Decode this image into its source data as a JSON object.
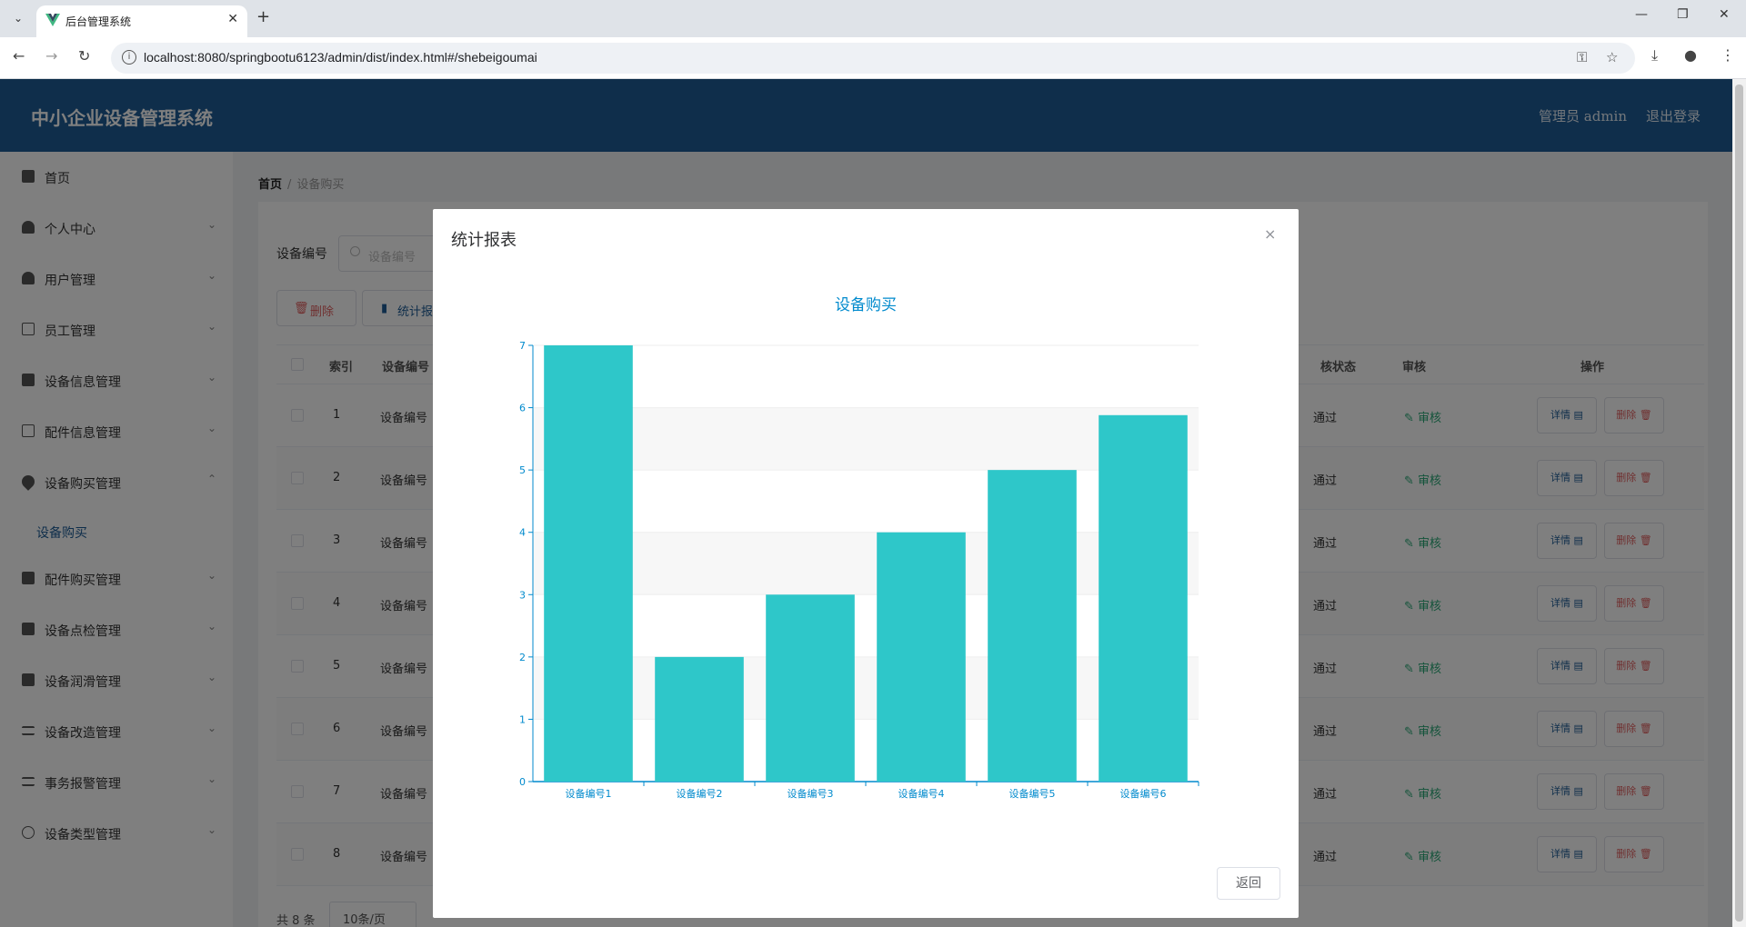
{
  "browser": {
    "tab_title": "后台管理系统",
    "url": "localhost:8080/springbootu6123/admin/dist/index.html#/shebeigoumai"
  },
  "header": {
    "brand": "中小企业设备管理系统",
    "user": "管理员 admin",
    "logout": "退出登录"
  },
  "sidebar": {
    "items": [
      {
        "label": "首页",
        "icon": "home-icon",
        "arrow": ""
      },
      {
        "label": "个人中心",
        "icon": "user-icon",
        "arrow": "⌄"
      },
      {
        "label": "用户管理",
        "icon": "user-icon",
        "arrow": "⌄"
      },
      {
        "label": "员工管理",
        "icon": "chat-icon",
        "arrow": "⌄"
      },
      {
        "label": "设备信息管理",
        "icon": "library-icon",
        "arrow": "⌄"
      },
      {
        "label": "配件信息管理",
        "icon": "card-icon",
        "arrow": "⌄"
      },
      {
        "label": "设备购买管理",
        "icon": "location-icon",
        "arrow": "⌃"
      },
      {
        "label": "配件购买管理",
        "icon": "clipboard-icon",
        "arrow": "⌄"
      },
      {
        "label": "设备点检管理",
        "icon": "chart-icon",
        "arrow": "⌄"
      },
      {
        "label": "设备润滑管理",
        "icon": "briefcase-icon",
        "arrow": "⌄"
      },
      {
        "label": "设备改造管理",
        "icon": "sliders-icon",
        "arrow": "⌄"
      },
      {
        "label": "事务报警管理",
        "icon": "list-icon",
        "arrow": "⌄"
      },
      {
        "label": "设备类型管理",
        "icon": "info-icon",
        "arrow": "⌄"
      }
    ],
    "sub_item": "设备购买"
  },
  "breadcrumb": {
    "home": "首页",
    "sep": "/",
    "current": "设备购买"
  },
  "search": {
    "label": "设备编号",
    "placeholder": "设备编号"
  },
  "toolbar": {
    "delete": "删除",
    "stats": "统计报"
  },
  "table": {
    "headers": {
      "index": "索引",
      "code": "设备编号",
      "status": "核状态",
      "audit": "审核",
      "ops": "操作"
    },
    "rows": [
      {
        "index": "1",
        "code": "设备编号",
        "status": "通过",
        "audit": "审核",
        "view": "详情",
        "remove": "删除"
      },
      {
        "index": "2",
        "code": "设备编号",
        "status": "通过",
        "audit": "审核",
        "view": "详情",
        "remove": "删除"
      },
      {
        "index": "3",
        "code": "设备编号",
        "status": "通过",
        "audit": "审核",
        "view": "详情",
        "remove": "删除"
      },
      {
        "index": "4",
        "code": "设备编号",
        "status": "通过",
        "audit": "审核",
        "view": "详情",
        "remove": "删除"
      },
      {
        "index": "5",
        "code": "设备编号",
        "status": "通过",
        "audit": "审核",
        "view": "详情",
        "remove": "删除"
      },
      {
        "index": "6",
        "code": "设备编号",
        "status": "通过",
        "audit": "审核",
        "view": "详情",
        "remove": "删除"
      },
      {
        "index": "7",
        "code": "设备编号",
        "status": "通过",
        "audit": "审核",
        "view": "详情",
        "remove": "删除"
      },
      {
        "index": "8",
        "code": "设备编号",
        "status": "通过",
        "audit": "审核",
        "view": "详情",
        "remove": "删除"
      }
    ]
  },
  "pager": {
    "total": "共 8 条",
    "size": "10条/页"
  },
  "modal": {
    "title": "统计报表",
    "close": "×",
    "back": "返回"
  },
  "chart_data": {
    "type": "bar",
    "title": "设备购买",
    "categories": [
      "设备编号1",
      "设备编号2",
      "设备编号3",
      "设备编号4",
      "设备编号5",
      "设备编号6"
    ],
    "values": [
      7,
      2,
      3,
      4,
      5,
      5.88
    ],
    "ylim": [
      0,
      7
    ],
    "yticks": [
      0,
      1,
      2,
      3,
      4,
      5,
      6,
      7
    ],
    "xlabel": "",
    "ylabel": "",
    "bar_color": "#2ec7c9",
    "axis_color": "#008acd",
    "grid": true
  },
  "colors": {
    "header": "#1e5d96",
    "accent": "#1e5d96",
    "danger": "#e06060",
    "success": "#29a876"
  }
}
